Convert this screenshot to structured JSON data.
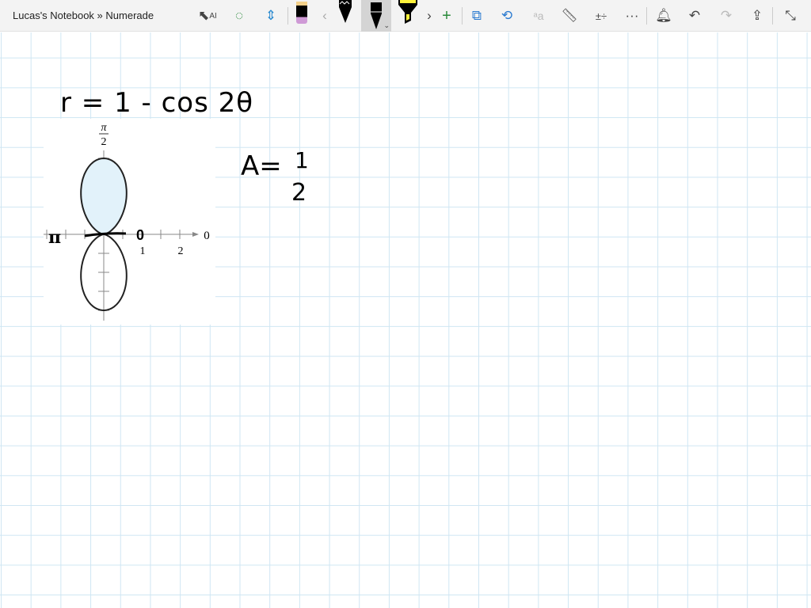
{
  "window": {
    "title": "Lucas's Notebook » Numerade"
  },
  "toolbar": {
    "items": [
      "lasso-select-icon",
      "add-shape-icon",
      "insert-space-icon",
      "eraser-pen",
      "chevron-left",
      "pencil",
      "pen",
      "highlighter",
      "chevron-right",
      "add-pen",
      "shape-recognition",
      "ink-to-shape",
      "ink-to-text",
      "ruler",
      "math",
      "more",
      "notification",
      "undo",
      "redo",
      "share",
      "exit-fullscreen"
    ],
    "more_label": "···"
  },
  "note": {
    "equation": "r = 1 - cos 2θ",
    "area": "A = 1/2",
    "area_lhs": "A=",
    "area_num": "1",
    "area_den": "2",
    "pi_label": "π",
    "zero_label": "0"
  },
  "graph": {
    "top_label_num": "π",
    "top_label_den": "2",
    "axis_label": "0",
    "tick1": "1",
    "tick2": "2",
    "fill": "#e2f2fa"
  }
}
